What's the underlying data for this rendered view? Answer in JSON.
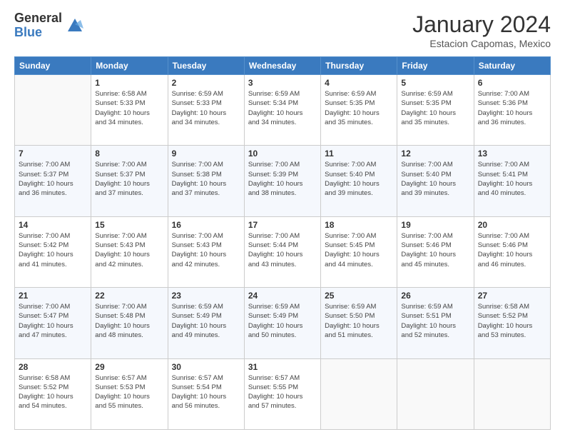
{
  "header": {
    "logo_general": "General",
    "logo_blue": "Blue",
    "month_title": "January 2024",
    "subtitle": "Estacion Capomas, Mexico"
  },
  "days_of_week": [
    "Sunday",
    "Monday",
    "Tuesday",
    "Wednesday",
    "Thursday",
    "Friday",
    "Saturday"
  ],
  "weeks": [
    [
      {
        "day": "",
        "info": ""
      },
      {
        "day": "1",
        "info": "Sunrise: 6:58 AM\nSunset: 5:33 PM\nDaylight: 10 hours\nand 34 minutes."
      },
      {
        "day": "2",
        "info": "Sunrise: 6:59 AM\nSunset: 5:33 PM\nDaylight: 10 hours\nand 34 minutes."
      },
      {
        "day": "3",
        "info": "Sunrise: 6:59 AM\nSunset: 5:34 PM\nDaylight: 10 hours\nand 34 minutes."
      },
      {
        "day": "4",
        "info": "Sunrise: 6:59 AM\nSunset: 5:35 PM\nDaylight: 10 hours\nand 35 minutes."
      },
      {
        "day": "5",
        "info": "Sunrise: 6:59 AM\nSunset: 5:35 PM\nDaylight: 10 hours\nand 35 minutes."
      },
      {
        "day": "6",
        "info": "Sunrise: 7:00 AM\nSunset: 5:36 PM\nDaylight: 10 hours\nand 36 minutes."
      }
    ],
    [
      {
        "day": "7",
        "info": "Sunrise: 7:00 AM\nSunset: 5:37 PM\nDaylight: 10 hours\nand 36 minutes."
      },
      {
        "day": "8",
        "info": "Sunrise: 7:00 AM\nSunset: 5:37 PM\nDaylight: 10 hours\nand 37 minutes."
      },
      {
        "day": "9",
        "info": "Sunrise: 7:00 AM\nSunset: 5:38 PM\nDaylight: 10 hours\nand 37 minutes."
      },
      {
        "day": "10",
        "info": "Sunrise: 7:00 AM\nSunset: 5:39 PM\nDaylight: 10 hours\nand 38 minutes."
      },
      {
        "day": "11",
        "info": "Sunrise: 7:00 AM\nSunset: 5:40 PM\nDaylight: 10 hours\nand 39 minutes."
      },
      {
        "day": "12",
        "info": "Sunrise: 7:00 AM\nSunset: 5:40 PM\nDaylight: 10 hours\nand 39 minutes."
      },
      {
        "day": "13",
        "info": "Sunrise: 7:00 AM\nSunset: 5:41 PM\nDaylight: 10 hours\nand 40 minutes."
      }
    ],
    [
      {
        "day": "14",
        "info": "Sunrise: 7:00 AM\nSunset: 5:42 PM\nDaylight: 10 hours\nand 41 minutes."
      },
      {
        "day": "15",
        "info": "Sunrise: 7:00 AM\nSunset: 5:43 PM\nDaylight: 10 hours\nand 42 minutes."
      },
      {
        "day": "16",
        "info": "Sunrise: 7:00 AM\nSunset: 5:43 PM\nDaylight: 10 hours\nand 42 minutes."
      },
      {
        "day": "17",
        "info": "Sunrise: 7:00 AM\nSunset: 5:44 PM\nDaylight: 10 hours\nand 43 minutes."
      },
      {
        "day": "18",
        "info": "Sunrise: 7:00 AM\nSunset: 5:45 PM\nDaylight: 10 hours\nand 44 minutes."
      },
      {
        "day": "19",
        "info": "Sunrise: 7:00 AM\nSunset: 5:46 PM\nDaylight: 10 hours\nand 45 minutes."
      },
      {
        "day": "20",
        "info": "Sunrise: 7:00 AM\nSunset: 5:46 PM\nDaylight: 10 hours\nand 46 minutes."
      }
    ],
    [
      {
        "day": "21",
        "info": "Sunrise: 7:00 AM\nSunset: 5:47 PM\nDaylight: 10 hours\nand 47 minutes."
      },
      {
        "day": "22",
        "info": "Sunrise: 7:00 AM\nSunset: 5:48 PM\nDaylight: 10 hours\nand 48 minutes."
      },
      {
        "day": "23",
        "info": "Sunrise: 6:59 AM\nSunset: 5:49 PM\nDaylight: 10 hours\nand 49 minutes."
      },
      {
        "day": "24",
        "info": "Sunrise: 6:59 AM\nSunset: 5:49 PM\nDaylight: 10 hours\nand 50 minutes."
      },
      {
        "day": "25",
        "info": "Sunrise: 6:59 AM\nSunset: 5:50 PM\nDaylight: 10 hours\nand 51 minutes."
      },
      {
        "day": "26",
        "info": "Sunrise: 6:59 AM\nSunset: 5:51 PM\nDaylight: 10 hours\nand 52 minutes."
      },
      {
        "day": "27",
        "info": "Sunrise: 6:58 AM\nSunset: 5:52 PM\nDaylight: 10 hours\nand 53 minutes."
      }
    ],
    [
      {
        "day": "28",
        "info": "Sunrise: 6:58 AM\nSunset: 5:52 PM\nDaylight: 10 hours\nand 54 minutes."
      },
      {
        "day": "29",
        "info": "Sunrise: 6:57 AM\nSunset: 5:53 PM\nDaylight: 10 hours\nand 55 minutes."
      },
      {
        "day": "30",
        "info": "Sunrise: 6:57 AM\nSunset: 5:54 PM\nDaylight: 10 hours\nand 56 minutes."
      },
      {
        "day": "31",
        "info": "Sunrise: 6:57 AM\nSunset: 5:55 PM\nDaylight: 10 hours\nand 57 minutes."
      },
      {
        "day": "",
        "info": ""
      },
      {
        "day": "",
        "info": ""
      },
      {
        "day": "",
        "info": ""
      }
    ]
  ]
}
